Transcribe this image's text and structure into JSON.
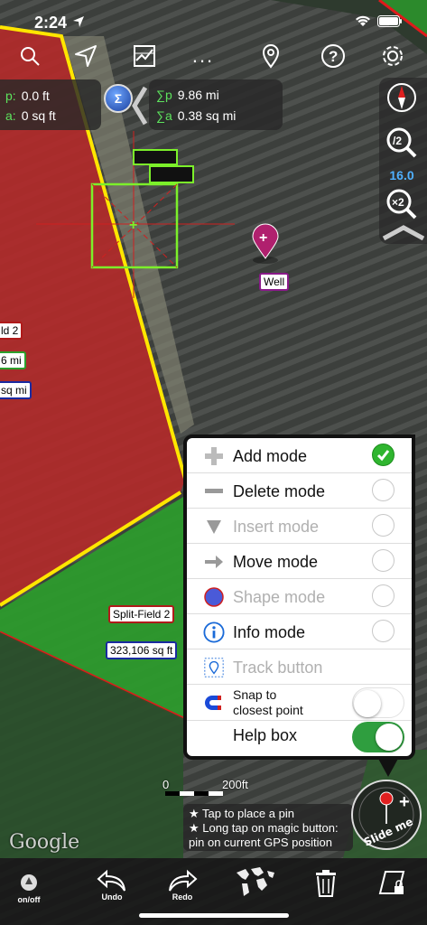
{
  "status": {
    "time": "2:24"
  },
  "toolbar": {
    "icons": [
      "search-icon",
      "location-arrow-icon",
      "map-layers-icon",
      "more-icon",
      "pin-icon",
      "help-icon",
      "settings-icon"
    ],
    "more_label": "..."
  },
  "measure": {
    "left": {
      "p_key": "p:",
      "p_val": "0.0 ft",
      "a_key": "a:",
      "a_val": "0 sq ft"
    },
    "sigma": "Σ",
    "right": {
      "p_key": "∑p",
      "p_val": "9.86 mi",
      "a_key": "∑a",
      "a_val": "0.38 sq mi"
    }
  },
  "zoom": {
    "level": "16.0",
    "in_label": "/2",
    "out_label": "×2"
  },
  "map_labels": {
    "well": "Well",
    "field2": "ld 2",
    "field2_perim": "6 mi",
    "field2_area": "sq mi",
    "split_field": "Split-Field 2",
    "split_area": "323,106 sq ft"
  },
  "menu": {
    "items": [
      {
        "label": "Add mode",
        "enabled": true,
        "selected": true
      },
      {
        "label": "Delete mode",
        "enabled": true,
        "selected": false
      },
      {
        "label": "Insert mode",
        "enabled": false,
        "selected": false
      },
      {
        "label": "Move mode",
        "enabled": true,
        "selected": false
      },
      {
        "label": "Shape mode",
        "enabled": false,
        "selected": false
      },
      {
        "label": "Info mode",
        "enabled": true,
        "selected": false
      },
      {
        "label": "Track button",
        "enabled": false
      }
    ],
    "snap_label_1": "Snap to",
    "snap_label_2": "closest point",
    "snap_on": false,
    "help_label": "Help box",
    "help_on": true
  },
  "scale": {
    "zero": "0",
    "distance": "200ft"
  },
  "help_text": {
    "line1": "★ Tap to place a pin",
    "line2": "★ Long tap on magic button:",
    "line3": "pin on current GPS position"
  },
  "magic_button": {
    "label": "Slide me"
  },
  "attribution": "Google",
  "bottom_bar": {
    "onoff": "on/off",
    "undo": "Undo",
    "redo": "Redo"
  },
  "colors": {
    "field_red": "#b22a2a",
    "field_green": "#2c9a2c",
    "accent_blue": "#4fb0ff",
    "toggle_green": "#2f9e3f"
  }
}
